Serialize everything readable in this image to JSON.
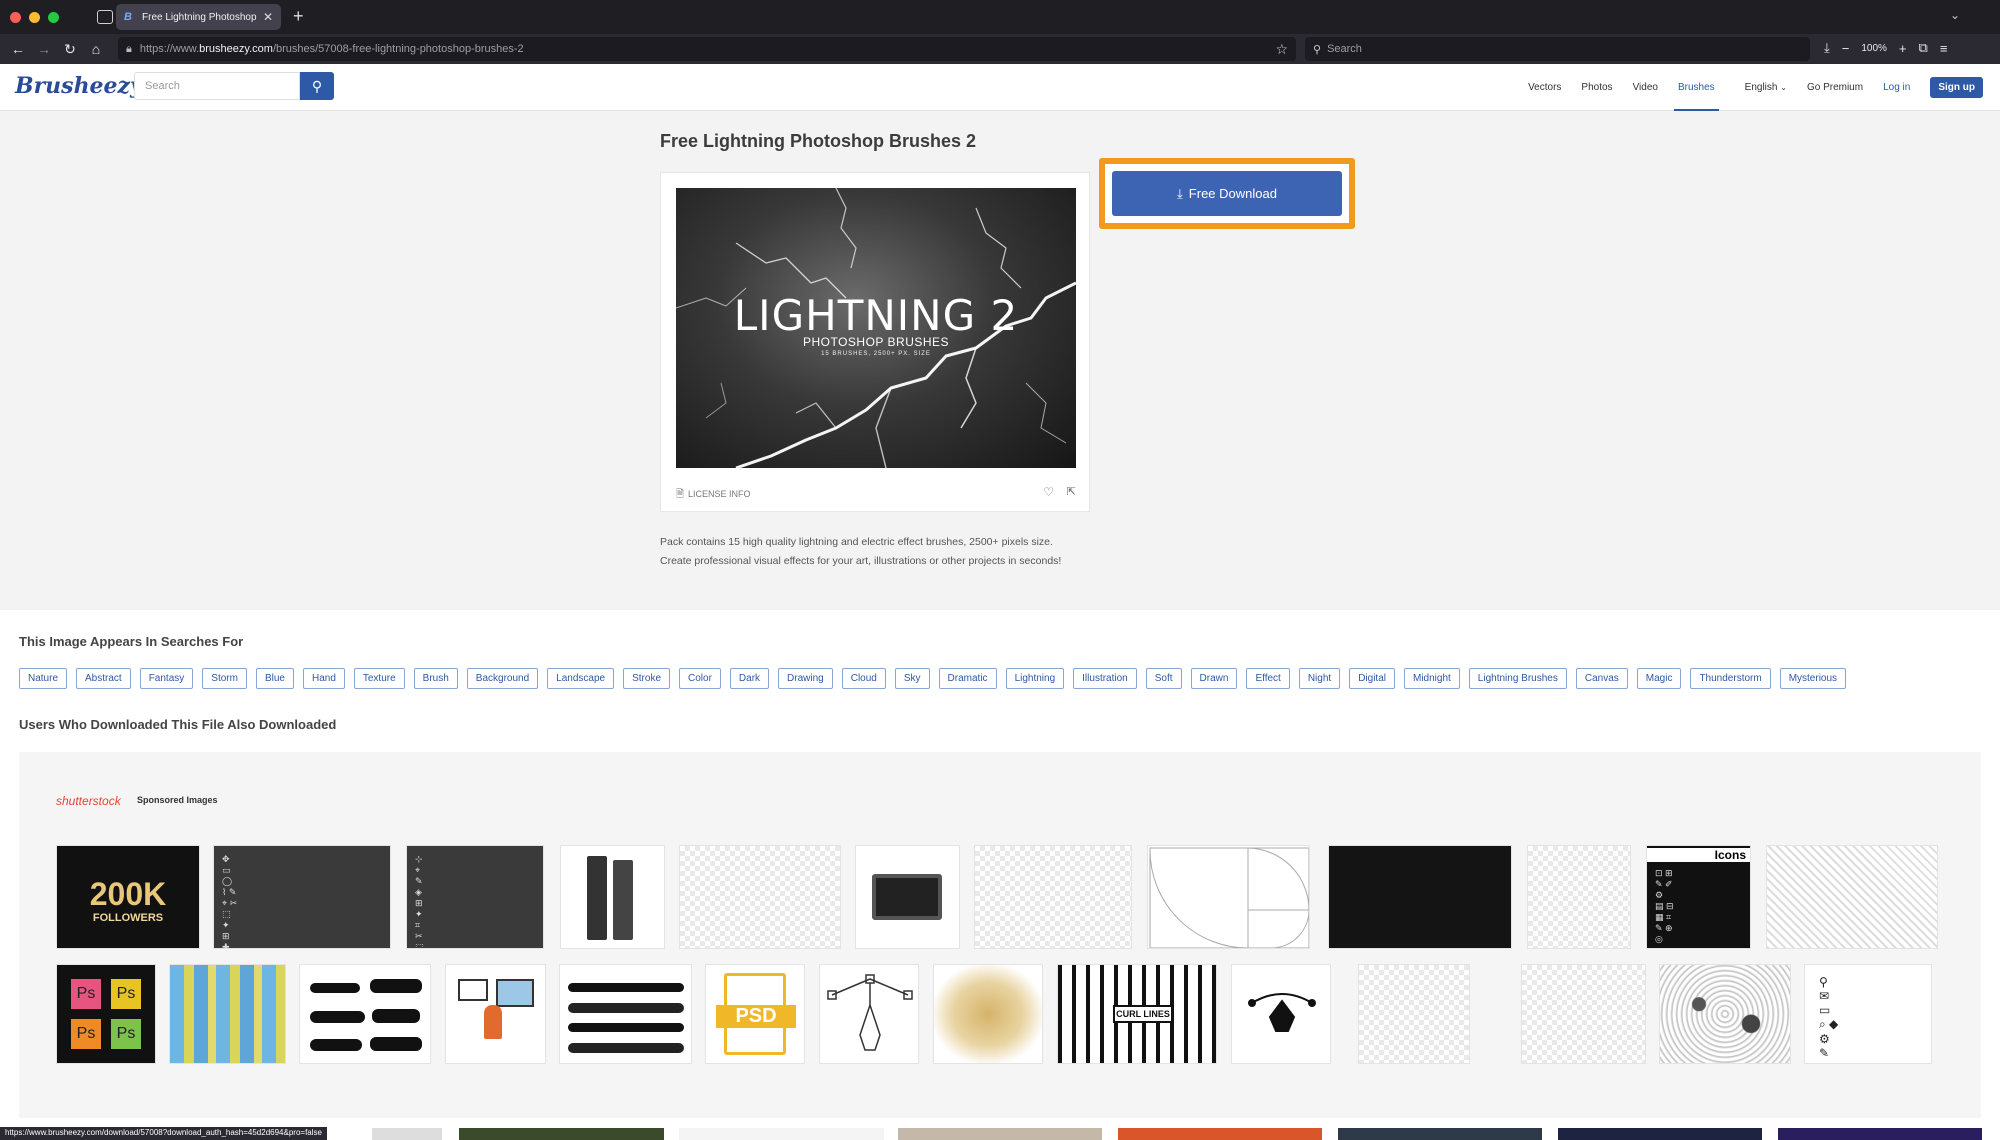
{
  "browser": {
    "tab_title": "Free Lightning Photoshop Brush",
    "tab_favicon": "B",
    "new_tab": "+",
    "url_prefix": "https://www.",
    "url_host": "brusheezy.com",
    "url_path": "/brushes/57008-free-lightning-photoshop-brushes-2",
    "search_placeholder": "Search",
    "zoom": "100%",
    "status_url": "https://www.brusheezy.com/download/57008?download_auth_hash=45d2d694&pro=false"
  },
  "site": {
    "logo": "Brusheezy",
    "search_placeholder": "Search",
    "nav": {
      "vectors": "Vectors",
      "photos": "Photos",
      "video": "Video",
      "brushes": "Brushes",
      "language": "English",
      "premium": "Go Premium",
      "login": "Log in",
      "signup": "Sign up"
    }
  },
  "resource": {
    "title": "Free Lightning Photoshop Brushes 2",
    "preview_title": "LIGHTNING 2",
    "preview_sub": "PHOTOSHOP BRUSHES",
    "preview_small": "15 BRUSHES, 2500+ PX. SIZE",
    "license": "LICENSE INFO",
    "download": "Free Download",
    "description_line1": "Pack contains 15 high quality lightning and electric effect brushes, 2500+ pixels size.",
    "description_line2": "Create professional visual effects for your art, illustrations or other projects in seconds!"
  },
  "searches": {
    "heading": "This Image Appears In Searches For",
    "tags": [
      "Nature",
      "Abstract",
      "Fantasy",
      "Storm",
      "Blue",
      "Hand",
      "Texture",
      "Brush",
      "Background",
      "Landscape",
      "Stroke",
      "Color",
      "Dark",
      "Drawing",
      "Cloud",
      "Sky",
      "Dramatic",
      "Lightning",
      "Illustration",
      "Soft",
      "Drawn",
      "Effect",
      "Night",
      "Digital",
      "Midnight",
      "Lightning Brushes",
      "Canvas",
      "Magic",
      "Thunderstorm",
      "Mysterious"
    ]
  },
  "also": {
    "heading": "Users Who Downloaded This File Also Downloaded",
    "sponsor_logo": "shutterstock",
    "sponsor_label": "Sponsored Images",
    "thumb_200k": "200K",
    "thumb_followers": "FOLLOWERS",
    "thumb_psd": "PSD",
    "thumb_curl": "CURL LINES",
    "thumb_icons": "Icons",
    "ps_labels": [
      "Ps",
      "Ps",
      "Ps",
      "Ps"
    ]
  },
  "colors": {
    "brand": "#2d59a6",
    "highlight": "#f29a1d"
  }
}
